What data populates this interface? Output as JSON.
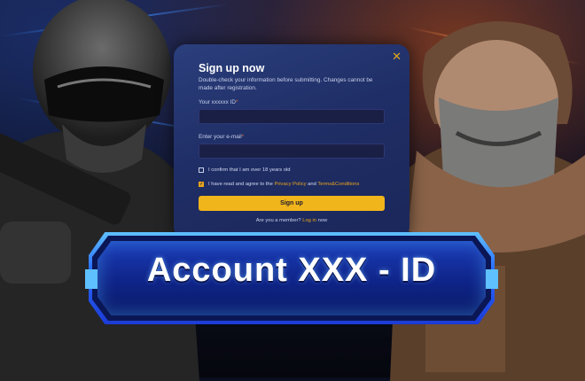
{
  "modal": {
    "title": "Sign up now",
    "subtitle": "Double-check your information before submitting. Changes cannot be made after registration.",
    "close_icon": "close-icon",
    "id_label": "Your xxxxxx ID",
    "id_required": "*",
    "email_label": "Enter your e-mail",
    "email_required": "*",
    "age_confirm": "I confirm that I am over 18 years old",
    "age_checked": false,
    "agree_prefix": "I have read and agree to the",
    "privacy_link": "Privacy Policy",
    "agree_and": "and",
    "terms_link": "Terms&Conditions",
    "agree_checked": true,
    "signup_button": "Sign up",
    "member_prefix": "Are you a member?",
    "login_link": "Log in",
    "member_suffix": "now"
  },
  "banner": {
    "text": "Account XXX - ID"
  },
  "colors": {
    "accent": "#f1b51c",
    "modal_bg": "#1f2e66",
    "banner_border": "#2a6dff"
  }
}
